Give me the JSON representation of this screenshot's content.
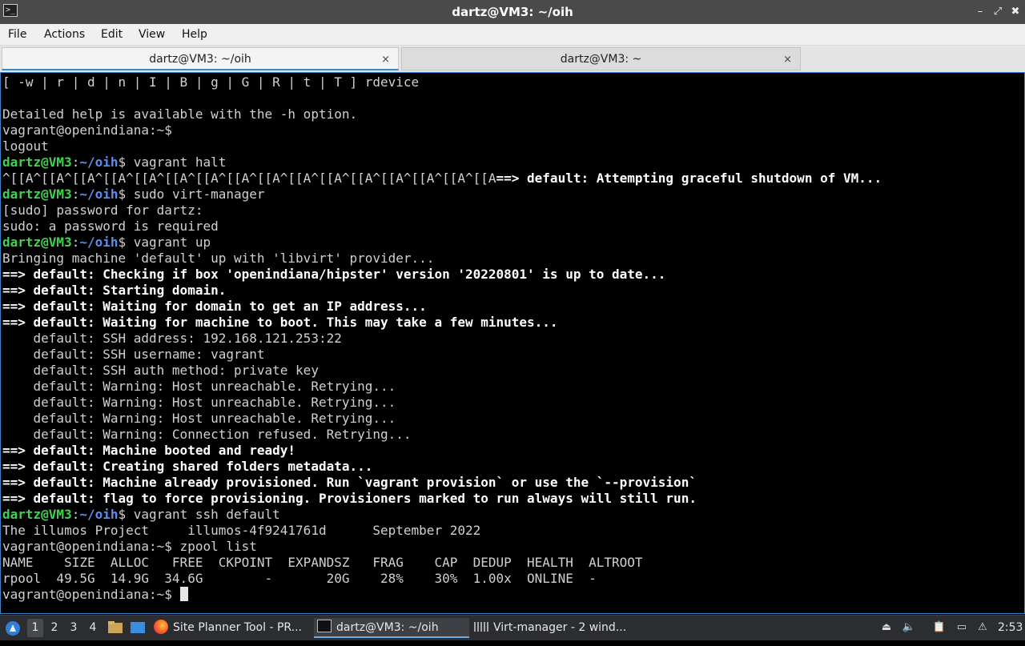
{
  "window": {
    "app_icon": ">_",
    "title": "dartz@VM3: ~/oih",
    "minimize_label": "–",
    "maximize_label": "⤢",
    "close_label": "✖"
  },
  "menu": [
    "File",
    "Actions",
    "Edit",
    "View",
    "Help"
  ],
  "tabs": [
    {
      "label": "dartz@VM3: ~/oih",
      "close": "×"
    },
    {
      "label": "dartz@VM3: ~",
      "close": "×"
    }
  ],
  "terminal": {
    "lines": [
      {
        "text": "[ -w | r | d | n | I | B | g | G | R | t | T ] rdevice"
      },
      {
        "text": ""
      },
      {
        "text": "Detailed help is available with the -h option."
      },
      {
        "text": "vagrant@openindiana:~$"
      },
      {
        "text": "logout"
      },
      {
        "prompt_user": "dartz@VM3",
        "prompt_sep": ":",
        "prompt_path": "~/oih",
        "prompt_end": "$ ",
        "command": "vagrant halt"
      },
      {
        "text": "^[[A^[[A^[[A^[[A^[[A^[[A^[[A^[[A^[[A^[[A^[[A^[[A^[[A^[[A^[[A^[[A",
        "bold": "==> default: Attempting graceful shutdown of VM..."
      },
      {
        "prompt_user": "dartz@VM3",
        "prompt_sep": ":",
        "prompt_path": "~/oih",
        "prompt_end": "$ ",
        "command": "sudo virt-manager"
      },
      {
        "text": "[sudo] password for dartz:"
      },
      {
        "text": "sudo: a password is required"
      },
      {
        "prompt_user": "dartz@VM3",
        "prompt_sep": ":",
        "prompt_path": "~/oih",
        "prompt_end": "$ ",
        "command": "vagrant up"
      },
      {
        "text": "Bringing machine 'default' up with 'libvirt' provider..."
      },
      {
        "bold": "==> default: Checking if box 'openindiana/hipster' version '20220801' is up to date..."
      },
      {
        "bold": "==> default: Starting domain."
      },
      {
        "bold": "==> default: Waiting for domain to get an IP address..."
      },
      {
        "bold": "==> default: Waiting for machine to boot. This may take a few minutes..."
      },
      {
        "text": "    default: SSH address: 192.168.121.253:22"
      },
      {
        "text": "    default: SSH username: vagrant"
      },
      {
        "text": "    default: SSH auth method: private key"
      },
      {
        "text": "    default: Warning: Host unreachable. Retrying..."
      },
      {
        "text": "    default: Warning: Host unreachable. Retrying..."
      },
      {
        "text": "    default: Warning: Host unreachable. Retrying..."
      },
      {
        "text": "    default: Warning: Connection refused. Retrying..."
      },
      {
        "bold": "==> default: Machine booted and ready!"
      },
      {
        "bold": "==> default: Creating shared folders metadata..."
      },
      {
        "bold": "==> default: Machine already provisioned. Run `vagrant provision` or use the `--provision`"
      },
      {
        "bold": "==> default: flag to force provisioning. Provisioners marked to run always will still run."
      },
      {
        "prompt_user": "dartz@VM3",
        "prompt_sep": ":",
        "prompt_path": "~/oih",
        "prompt_end": "$ ",
        "command": "vagrant ssh default"
      },
      {
        "text": "The illumos Project     illumos-4f9241761d      September 2022"
      },
      {
        "text": "vagrant@openindiana:~$ zpool list"
      },
      {
        "text": "NAME    SIZE  ALLOC   FREE  CKPOINT  EXPANDSZ   FRAG    CAP  DEDUP  HEALTH  ALTROOT"
      },
      {
        "text": "rpool  49.5G  14.9G  34.6G        -       20G    28%    30%  1.00x  ONLINE  -"
      },
      {
        "text": "vagrant@openindiana:~$ ",
        "cursor": true
      }
    ]
  },
  "taskbar": {
    "workspaces": [
      "1",
      "2",
      "3",
      "4"
    ],
    "tasks": [
      {
        "label": "Site Planner Tool - PR..."
      },
      {
        "label": "dartz@VM3: ~/oih"
      },
      {
        "label": "Virt-manager - 2 wind..."
      }
    ],
    "clock": "2:53"
  }
}
